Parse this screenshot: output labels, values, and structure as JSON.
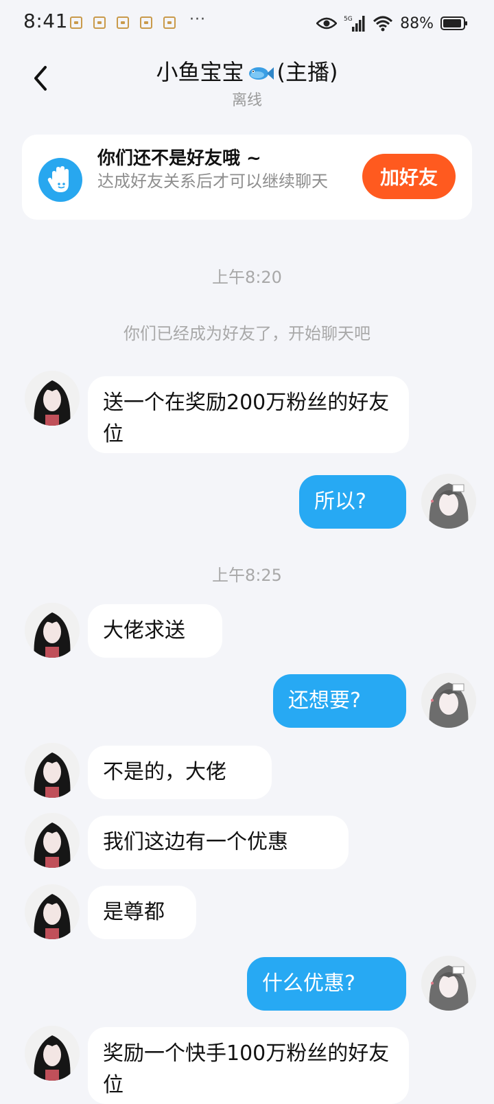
{
  "status_bar": {
    "time": "8:41",
    "dots": "···",
    "network": "5G",
    "battery": "88%"
  },
  "header": {
    "name": "小鱼宝宝",
    "role": "(主播)",
    "status": "离线"
  },
  "banner": {
    "title": "你们还不是好友哦 ~",
    "description": "达成好友关系后才可以继续聊天",
    "button": "加好友"
  },
  "chat": {
    "timestamp_1": "上午8:20",
    "system_message": "你们已经成为好友了，开始聊天吧",
    "timestamp_2": "上午8:25",
    "messages": [
      {
        "side": "left",
        "text": "送一个在奖励200万粉丝的好友位"
      },
      {
        "side": "right",
        "text": "所以?"
      },
      {
        "side": "left",
        "text": "大佬求送"
      },
      {
        "side": "right",
        "text": "还想要?"
      },
      {
        "side": "left",
        "text": "不是的，大佬"
      },
      {
        "side": "left",
        "text": "我们这边有一个优惠"
      },
      {
        "side": "left",
        "text": "是尊都"
      },
      {
        "side": "right",
        "text": "什么优惠?"
      },
      {
        "side": "left",
        "text": "奖励一个快手100万粉丝的好友位"
      }
    ]
  },
  "colors": {
    "accent": "#27a9f3",
    "add_button": "#ff5a1f",
    "background": "#f4f5f9"
  }
}
